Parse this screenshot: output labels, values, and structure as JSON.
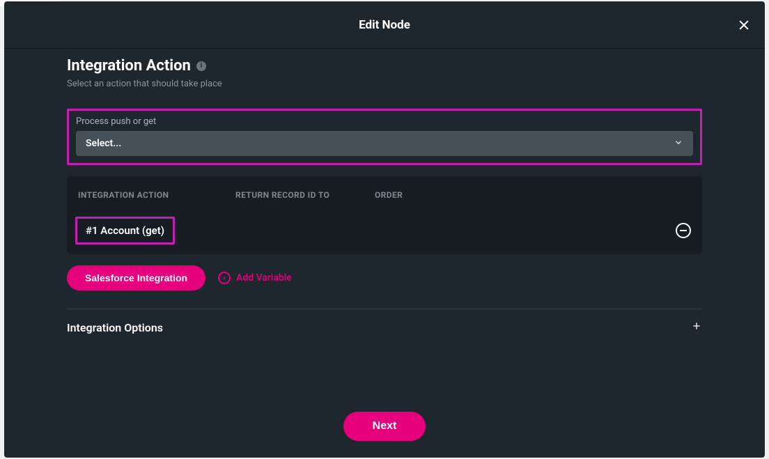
{
  "modal": {
    "title": "Edit Node",
    "close_aria": "Close"
  },
  "section": {
    "title": "Integration Action",
    "subtitle": "Select an action that should take place"
  },
  "process_field": {
    "label": "Process push or get",
    "placeholder": "Select..."
  },
  "table": {
    "headers": {
      "action": "INTEGRATION ACTION",
      "return": "RETURN RECORD ID TO",
      "order": "ORDER"
    },
    "rows": [
      {
        "label": "#1 Account (get)"
      }
    ]
  },
  "buttons": {
    "salesforce": "Salesforce Integration",
    "add_variable": "Add Variable",
    "next": "Next"
  },
  "options": {
    "label": "Integration Options"
  },
  "colors": {
    "accent": "#e6007e",
    "highlight_border": "#c41fb4",
    "panel_bg": "#1f272e",
    "card_bg": "#171d23",
    "select_bg": "#455059"
  }
}
